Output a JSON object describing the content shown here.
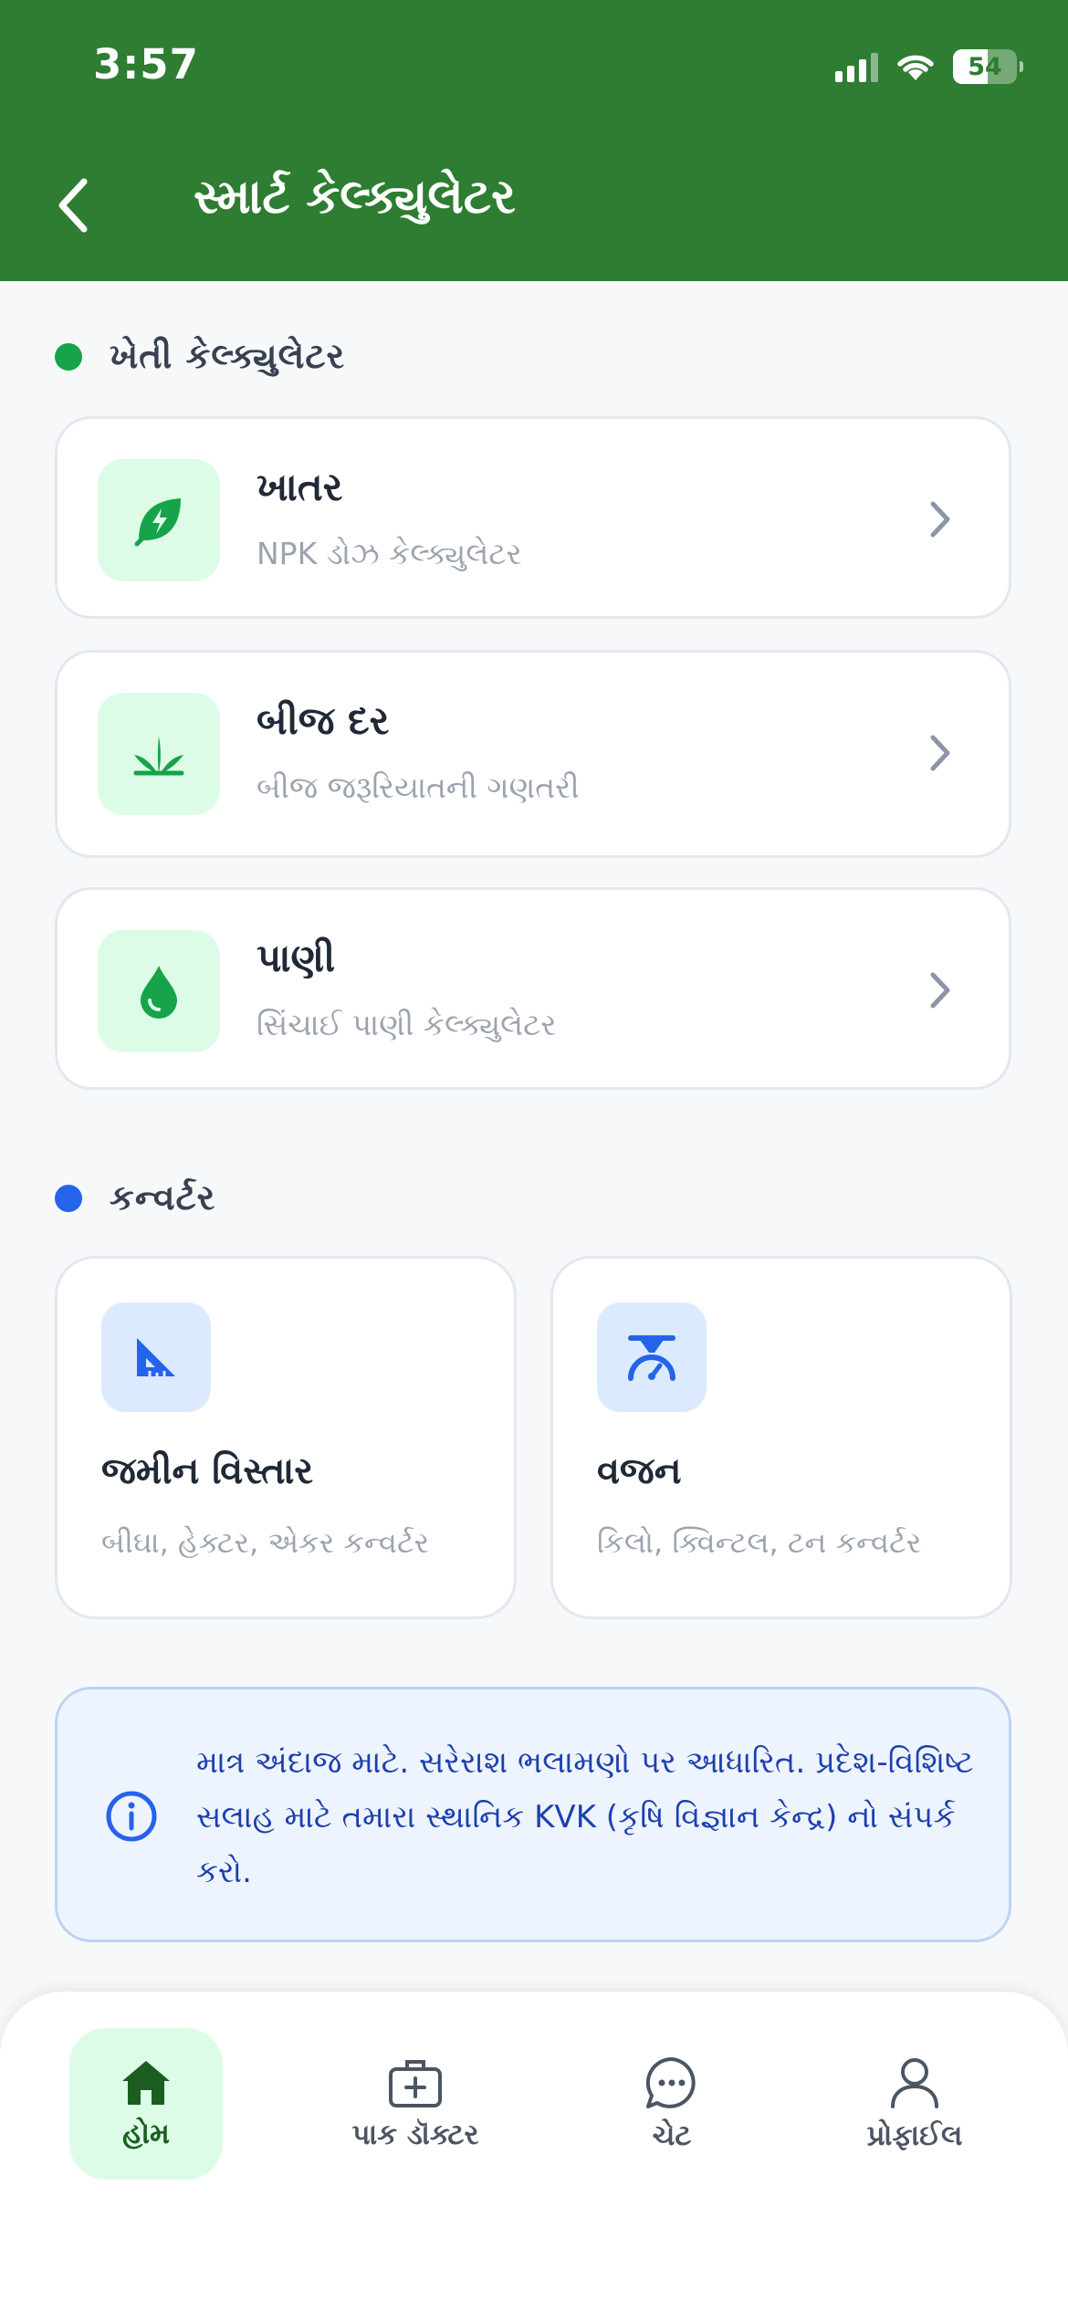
{
  "status_bar": {
    "time": "3:57",
    "battery": "54",
    "battery_level": 0.54
  },
  "header": {
    "title": "સ્માર્ટ કેલ્ક્યુલેટર"
  },
  "farm_section": {
    "title": "ખેતી કેલ્ક્યુલેટર",
    "dot_color": "#16a34a",
    "items": [
      {
        "title": "ખાતર",
        "subtitle": "NPK ડોઝ કેલ્ક્યુલેટર",
        "icon": "leaf-bolt-icon"
      },
      {
        "title": "બીજ દર",
        "subtitle": "બીજ જરૂરિયાતની ગણતરી",
        "icon": "sprout-icon"
      },
      {
        "title": "પાણી",
        "subtitle": "સિંચાઈ પાણી કેલ્ક્યુલેટર",
        "icon": "water-drop-icon"
      }
    ]
  },
  "converter_section": {
    "title": "કન્વર્ટર",
    "dot_color": "#2563eb",
    "items": [
      {
        "title": "જમીન વિસ્તાર",
        "subtitle": "બીઘા, હેક્ટર, એકર કન્વર્ટર",
        "icon": "set-square-icon"
      },
      {
        "title": "વજન",
        "subtitle": "કિલો, ક્વિન્ટલ, ટન કન્વર્ટર",
        "icon": "weight-scale-icon"
      }
    ]
  },
  "notice": {
    "text": "માત્ર અંદાજ માટે. સરેરાશ ભલામણો પર આધારિત. પ્રદેશ-વિશિષ્ટ સલાહ માટે તમારા સ્થાનિક KVK (કૃષિ વિજ્ઞાન કેન્દ્ર) નો સંપર્ક કરો.",
    "icon": "info-icon"
  },
  "tabs": [
    {
      "label": "હોમ",
      "icon": "home-icon",
      "active": true
    },
    {
      "label": "પાક ડૉક્ટર",
      "icon": "medical-kit-icon",
      "active": false
    },
    {
      "label": "ચેટ",
      "icon": "chat-bubble-icon",
      "active": false
    },
    {
      "label": "પ્રોફાઈલ",
      "icon": "user-icon",
      "active": false
    }
  ],
  "colors": {
    "primary": "#2e7d32",
    "green_tint": "#dcfce7",
    "blue_tint": "#dbeafe",
    "blue_accent": "#2563eb"
  }
}
